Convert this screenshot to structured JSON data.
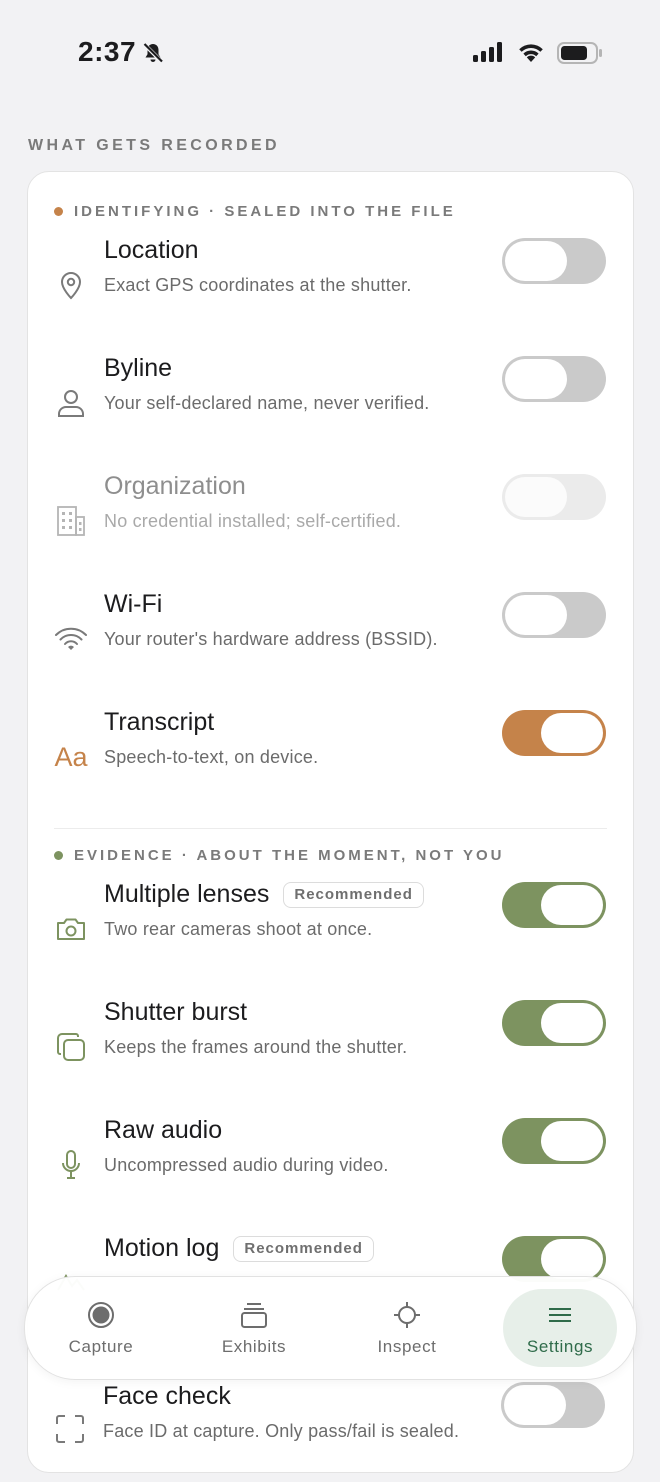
{
  "status": {
    "time": "2:37"
  },
  "section_title": "WHAT GETS RECORDED",
  "groups": [
    {
      "label": "IDENTIFYING · SEALED INTO THE FILE",
      "dot_color": "#c5834a",
      "items": [
        {
          "title": "Location",
          "desc": "Exact GPS coordinates at the shutter.",
          "icon": "location-pin-icon",
          "state": "off"
        },
        {
          "title": "Byline",
          "desc": "Your self-declared name, never verified.",
          "icon": "person-icon",
          "state": "off"
        },
        {
          "title": "Organization",
          "desc": "No credential installed; self-certified.",
          "icon": "building-icon",
          "state": "disabled"
        },
        {
          "title": "Wi-Fi",
          "desc": "Your router's hardware address (BSSID).",
          "icon": "wifi-icon",
          "state": "off"
        },
        {
          "title": "Transcript",
          "desc": "Speech-to-text, on device.",
          "icon": "text-aa-icon",
          "icon_glyph": "Aa",
          "state": "on"
        }
      ]
    },
    {
      "label": "EVIDENCE · ABOUT THE MOMENT, NOT YOU",
      "dot_color": "#7d9360",
      "items": [
        {
          "title": "Multiple lenses",
          "badge": "Recommended",
          "desc": "Two rear cameras shoot at once.",
          "icon": "camera-icon",
          "state": "on"
        },
        {
          "title": "Shutter burst",
          "desc": "Keeps the frames around the shutter.",
          "icon": "stacked-frames-icon",
          "state": "on"
        },
        {
          "title": "Raw audio",
          "desc": "Uncompressed audio during video.",
          "icon": "microphone-icon",
          "state": "on"
        },
        {
          "title": "Motion log",
          "badge": "Recommended",
          "desc": "",
          "icon": "motion-icon",
          "state": "on"
        },
        {
          "title": "Face check",
          "desc": "Face ID at capture. Only pass/fail is sealed.",
          "icon": "face-scan-icon",
          "state": "off"
        }
      ]
    }
  ],
  "tabs": [
    {
      "label": "Capture",
      "icon": "capture-icon",
      "active": false
    },
    {
      "label": "Exhibits",
      "icon": "exhibits-icon",
      "active": false
    },
    {
      "label": "Inspect",
      "icon": "crosshair-icon",
      "active": false
    },
    {
      "label": "Settings",
      "icon": "menu-lines-icon",
      "active": true
    }
  ],
  "colors": {
    "orange": "#c5834a",
    "green": "#7d9360",
    "active_tab_bg": "#e7efe9",
    "active_tab_text": "#2f6b4a"
  }
}
